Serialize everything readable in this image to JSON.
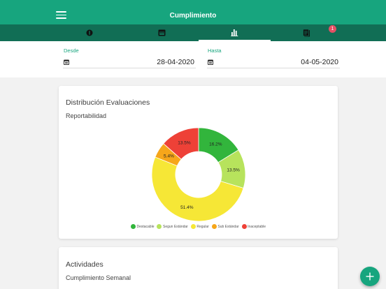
{
  "header": {
    "title": "Cumplimiento"
  },
  "tabs": [
    {
      "icon": "coin-icon"
    },
    {
      "icon": "calendar-icon"
    },
    {
      "icon": "bar-chart-icon",
      "active": true
    },
    {
      "icon": "notes-icon",
      "badge": "1"
    }
  ],
  "filters": {
    "from": {
      "label": "Desde",
      "value": "28-04-2020"
    },
    "to": {
      "label": "Hasta",
      "value": "04-05-2020"
    }
  },
  "card_distribution": {
    "title": "Distribución Evaluaciones",
    "subtitle": "Reportabilidad"
  },
  "chart_data": {
    "type": "pie",
    "subtype": "donut",
    "categories": [
      "Destacable",
      "Segun Estándar",
      "Regular",
      "Sub Estándar",
      "Inaceptable"
    ],
    "values": [
      16.2,
      13.5,
      51.4,
      5.4,
      13.5
    ],
    "labels": [
      "16.2%",
      "13.5%",
      "51.4%",
      "5.4%",
      "13.5%"
    ],
    "colors": [
      "#32b53c",
      "#b7e35c",
      "#f6e736",
      "#f6a61a",
      "#ee4137"
    ],
    "legend": "bottom"
  },
  "card_activities": {
    "title": "Actividades",
    "subtitle": "Cumplimiento Semanal"
  },
  "fab": {
    "icon": "plus-icon"
  },
  "colors": {
    "primary": "#17a57e",
    "primary_dark": "#116e55",
    "badge": "#e45064"
  }
}
